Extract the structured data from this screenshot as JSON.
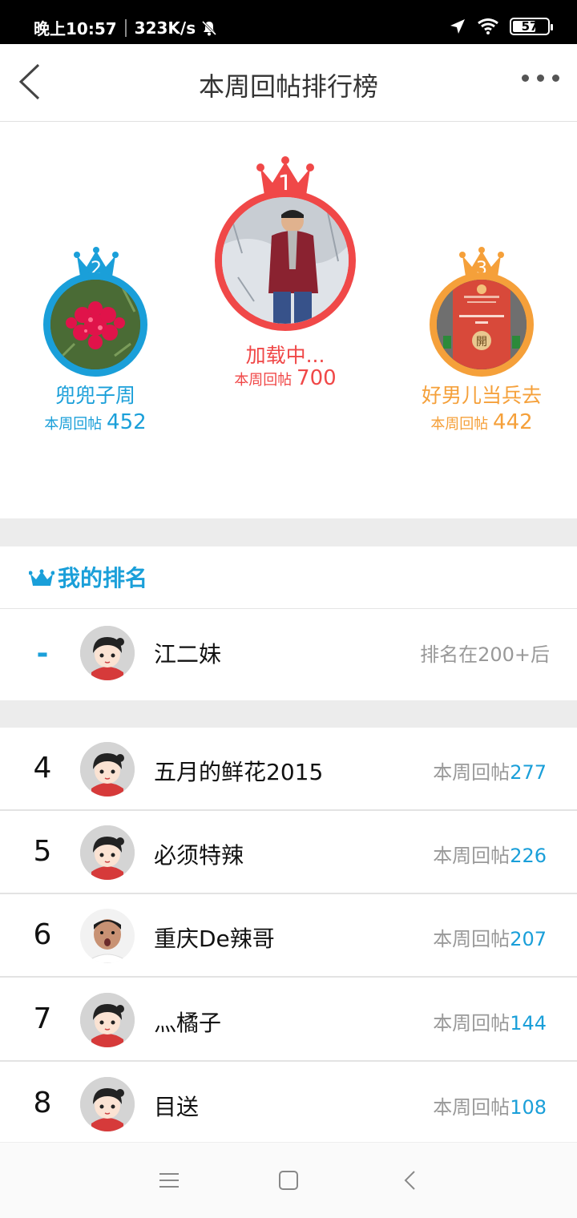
{
  "status_bar": {
    "time": "晚上10:57",
    "net_speed": "323K/s",
    "battery": "57"
  },
  "nav": {
    "title": "本周回帖排行榜"
  },
  "podium": {
    "stat_label": "本周回帖",
    "first": {
      "rank": "1",
      "name": "加载中...",
      "count": "700",
      "color": "#f04848"
    },
    "second": {
      "rank": "2",
      "name": "兜兜子周",
      "count": "452",
      "color": "#1a9fd9"
    },
    "third": {
      "rank": "3",
      "name": "好男儿当兵去",
      "count": "442",
      "color": "#f5a03a",
      "red_packet_button": "開"
    }
  },
  "my_rank": {
    "header": "我的排名",
    "rank": "-",
    "name": "江二妹",
    "status": "排名在200+后"
  },
  "ranking": {
    "stat_label": "本周回帖",
    "rows": [
      {
        "rank": "4",
        "name": "五月的鲜花2015",
        "count": "277"
      },
      {
        "rank": "5",
        "name": "必须特辣",
        "count": "226"
      },
      {
        "rank": "6",
        "name": "重庆De辣哥",
        "count": "207"
      },
      {
        "rank": "7",
        "name": "灬橘子",
        "count": "144"
      },
      {
        "rank": "8",
        "name": "目送",
        "count": "108"
      }
    ]
  },
  "colors": {
    "accent": "#1a9fd9",
    "gold": "#f04848",
    "silver": "#1a9fd9",
    "bronze": "#f5a03a"
  }
}
